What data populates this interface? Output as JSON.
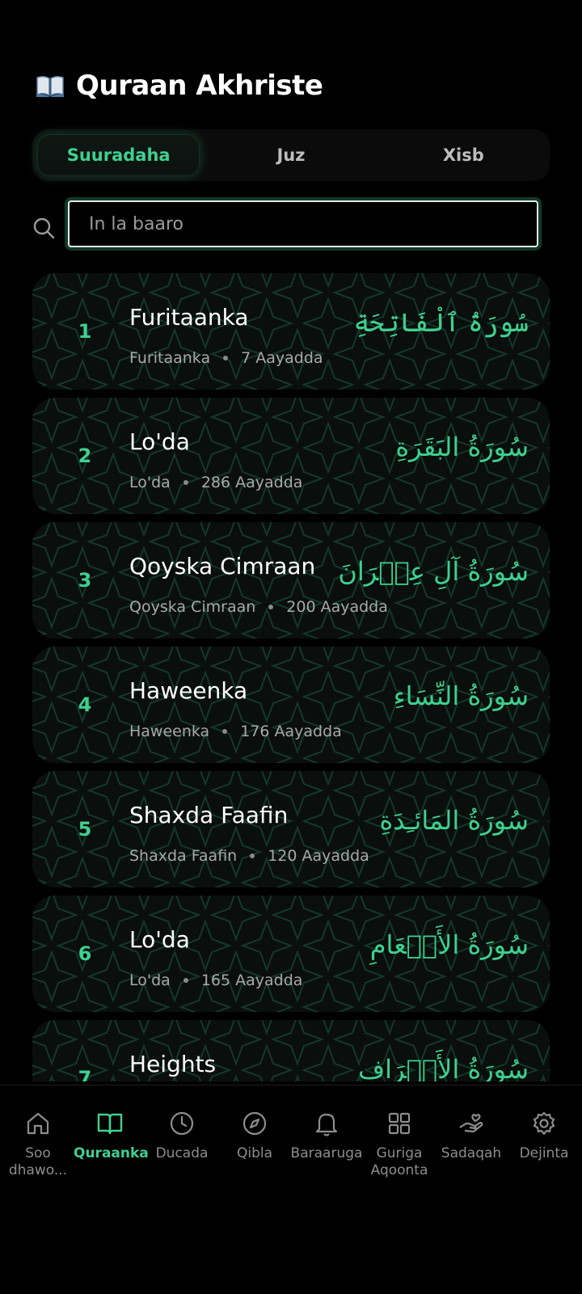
{
  "header": {
    "title": "Quraan Akhriste",
    "icon": "open-book-icon"
  },
  "tabs": [
    {
      "label": "Suuradaha",
      "active": true
    },
    {
      "label": "Juz",
      "active": false
    },
    {
      "label": "Xisb",
      "active": false
    }
  ],
  "search": {
    "placeholder": "In la baaro",
    "value": ""
  },
  "surahs": [
    {
      "number": "1",
      "name": "Furitaanka",
      "subtitle": "Furitaanka",
      "ayahs": "7 Aayadda",
      "arabic": "سُورَةُ ٱلْفَاتِحَةِ"
    },
    {
      "number": "2",
      "name": "Lo'da",
      "subtitle": "Lo'da",
      "ayahs": "286 Aayadda",
      "arabic": "سُورَةُ البَقَرَةِ"
    },
    {
      "number": "3",
      "name": "Qoyska Cimraan",
      "subtitle": "Qoyska Cimraan",
      "ayahs": "200 Aayadda",
      "arabic": "سُورَةُ آلِ عِمۡرَانَ"
    },
    {
      "number": "4",
      "name": "Haweenka",
      "subtitle": "Haweenka",
      "ayahs": "176 Aayadda",
      "arabic": "سُورَةُ النِّسَاءِ"
    },
    {
      "number": "5",
      "name": "Shaxda Faafin",
      "subtitle": "Shaxda Faafin",
      "ayahs": "120 Aayadda",
      "arabic": "سُورَةُ المَائـِدَةِ"
    },
    {
      "number": "6",
      "name": "Lo'da",
      "subtitle": "Lo'da",
      "ayahs": "165 Aayadda",
      "arabic": "سُورَةُ الأَنۡعَامِ"
    },
    {
      "number": "7",
      "name": "Heights",
      "subtitle": "",
      "ayahs": "",
      "arabic": "سُورَةُ الأَعۡرَافِ"
    }
  ],
  "nav": [
    {
      "label": "Soo dhawo...",
      "icon": "home-icon",
      "active": false
    },
    {
      "label": "Quraanka",
      "icon": "open-book-icon",
      "active": true
    },
    {
      "label": "Ducada",
      "icon": "clock-icon",
      "active": false
    },
    {
      "label": "Qibla",
      "icon": "compass-icon",
      "active": false
    },
    {
      "label": "Baraaruga",
      "icon": "bell-icon",
      "active": false
    },
    {
      "label": "Guriga Aqoonta",
      "icon": "grid-icon",
      "active": false
    },
    {
      "label": "Sadaqah",
      "icon": "hand-heart-icon",
      "active": false
    },
    {
      "label": "Dejinta",
      "icon": "gear-icon",
      "active": false
    }
  ],
  "colors": {
    "accent": "#3fcf8e",
    "background": "#000000",
    "card": "#0a0e0c"
  }
}
